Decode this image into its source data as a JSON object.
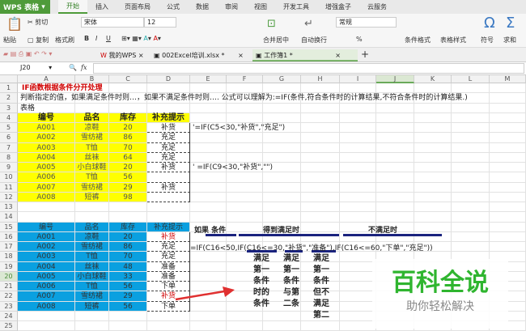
{
  "app": {
    "name": "WPS 表格",
    "menu_tabs": [
      "开始",
      "插入",
      "页面布局",
      "公式",
      "数据",
      "审阅",
      "视图",
      "开发工具",
      "增强盒子",
      "云服务"
    ],
    "active_tab": "开始"
  },
  "ribbon": {
    "paste": "粘贴",
    "cut": "剪切",
    "copy": "复制",
    "format_painter": "格式刷",
    "font": "宋体",
    "font_size": "12",
    "bold": "B",
    "italic": "I",
    "underline": "U",
    "merge": "合并居中",
    "wrap": "自动换行",
    "number_format": "常规",
    "percent": "%",
    "cond_format": "条件格式",
    "table_style": "表格样式",
    "symbol": "符号",
    "sum": "求和"
  },
  "doc_tabs": [
    {
      "label": "我的WPS"
    },
    {
      "label": "002Excel培训.xlsx *"
    },
    {
      "label": "工作簿1 *",
      "active": true
    }
  ],
  "formula_bar": {
    "cell_ref": "J20",
    "fx": "fx",
    "value": ""
  },
  "columns": [
    "A",
    "B",
    "C",
    "D",
    "E",
    "F",
    "G",
    "H",
    "I",
    "J",
    "K",
    "L",
    "M"
  ],
  "selected_column": "J",
  "selected_row": 20,
  "rows": 25,
  "colors": {
    "yellow": "#ffff00",
    "blue": "#0aa0e0",
    "red": "#d00000",
    "navy": "#1a237e",
    "green": "#2fb52f"
  },
  "cells": [
    {
      "r": 1,
      "c": 0,
      "t": "IF函数根据条件分开处理",
      "s": "title"
    },
    {
      "r": 2,
      "c": 0,
      "t": "判断指定的值，如果满足条件时则…，如果不满足条件时则…. 公式可以理解为:=IF(条件,符合条件时的计算结果,不符合条件时的计算结果.)",
      "s": "left"
    },
    {
      "r": 3,
      "c": 0,
      "t": "表格",
      "s": "left"
    },
    {
      "r": 4,
      "c": 0,
      "t": "编号",
      "s": "yh"
    },
    {
      "r": 4,
      "c": 1,
      "t": "品名",
      "s": "yh"
    },
    {
      "r": 4,
      "c": 2,
      "t": "库存",
      "s": "yh"
    },
    {
      "r": 4,
      "c": 3,
      "t": "补充提示",
      "s": "yh"
    },
    {
      "r": 5,
      "c": 0,
      "t": "A001",
      "s": "y"
    },
    {
      "r": 5,
      "c": 1,
      "t": "凉鞋",
      "s": "y"
    },
    {
      "r": 5,
      "c": 2,
      "t": "20",
      "s": "y"
    },
    {
      "r": 5,
      "c": 3,
      "t": "补货",
      "s": "w"
    },
    {
      "r": 6,
      "c": 0,
      "t": "A002",
      "s": "y"
    },
    {
      "r": 6,
      "c": 1,
      "t": "雪纺裙",
      "s": "y"
    },
    {
      "r": 6,
      "c": 2,
      "t": "86",
      "s": "y"
    },
    {
      "r": 6,
      "c": 3,
      "t": "充足",
      "s": "w"
    },
    {
      "r": 7,
      "c": 0,
      "t": "A003",
      "s": "y"
    },
    {
      "r": 7,
      "c": 1,
      "t": "T恤",
      "s": "y"
    },
    {
      "r": 7,
      "c": 2,
      "t": "70",
      "s": "y"
    },
    {
      "r": 7,
      "c": 3,
      "t": "充足",
      "s": "w"
    },
    {
      "r": 8,
      "c": 0,
      "t": "A004",
      "s": "y"
    },
    {
      "r": 8,
      "c": 1,
      "t": "丝袜",
      "s": "y"
    },
    {
      "r": 8,
      "c": 2,
      "t": "64",
      "s": "y"
    },
    {
      "r": 8,
      "c": 3,
      "t": "充足",
      "s": "w"
    },
    {
      "r": 9,
      "c": 0,
      "t": "A005",
      "s": "y"
    },
    {
      "r": 9,
      "c": 1,
      "t": "小白球鞋",
      "s": "y"
    },
    {
      "r": 9,
      "c": 2,
      "t": "20",
      "s": "y"
    },
    {
      "r": 9,
      "c": 3,
      "t": "补货",
      "s": "w"
    },
    {
      "r": 10,
      "c": 0,
      "t": "A006",
      "s": "y"
    },
    {
      "r": 10,
      "c": 1,
      "t": "T恤",
      "s": "y"
    },
    {
      "r": 10,
      "c": 2,
      "t": "56",
      "s": "y"
    },
    {
      "r": 10,
      "c": 3,
      "t": "",
      "s": "w"
    },
    {
      "r": 11,
      "c": 0,
      "t": "A007",
      "s": "y"
    },
    {
      "r": 11,
      "c": 1,
      "t": "雪纺裙",
      "s": "y"
    },
    {
      "r": 11,
      "c": 2,
      "t": "29",
      "s": "y"
    },
    {
      "r": 11,
      "c": 3,
      "t": "补货",
      "s": "w"
    },
    {
      "r": 12,
      "c": 0,
      "t": "A008",
      "s": "y"
    },
    {
      "r": 12,
      "c": 1,
      "t": "短裤",
      "s": "y"
    },
    {
      "r": 12,
      "c": 2,
      "t": "98",
      "s": "y"
    },
    {
      "r": 12,
      "c": 3,
      "t": "",
      "s": "w"
    },
    {
      "r": 5,
      "c": 4,
      "t": "'=IF(C5<30,\"补货\",\"充足\")",
      "s": "left"
    },
    {
      "r": 9,
      "c": 4,
      "t": "' =IF(C9<30,\"补货\",\"\")",
      "s": "left"
    },
    {
      "r": 15,
      "c": 0,
      "t": "编号",
      "s": "b"
    },
    {
      "r": 15,
      "c": 1,
      "t": "品名",
      "s": "b"
    },
    {
      "r": 15,
      "c": 2,
      "t": "库存",
      "s": "b"
    },
    {
      "r": 15,
      "c": 3,
      "t": "补充提示",
      "s": "b"
    },
    {
      "r": 16,
      "c": 0,
      "t": "A001",
      "s": "b"
    },
    {
      "r": 16,
      "c": 1,
      "t": "凉鞋",
      "s": "b"
    },
    {
      "r": 16,
      "c": 2,
      "t": "20",
      "s": "b"
    },
    {
      "r": 16,
      "c": 3,
      "t": "补货",
      "s": "wr"
    },
    {
      "r": 17,
      "c": 0,
      "t": "A002",
      "s": "b"
    },
    {
      "r": 17,
      "c": 1,
      "t": "雪纺裙",
      "s": "b"
    },
    {
      "r": 17,
      "c": 2,
      "t": "86",
      "s": "b"
    },
    {
      "r": 17,
      "c": 3,
      "t": "充足",
      "s": "w"
    },
    {
      "r": 18,
      "c": 0,
      "t": "A003",
      "s": "b"
    },
    {
      "r": 18,
      "c": 1,
      "t": "T恤",
      "s": "b"
    },
    {
      "r": 18,
      "c": 2,
      "t": "70",
      "s": "b"
    },
    {
      "r": 18,
      "c": 3,
      "t": "充足",
      "s": "w"
    },
    {
      "r": 19,
      "c": 0,
      "t": "A004",
      "s": "b"
    },
    {
      "r": 19,
      "c": 1,
      "t": "丝袜",
      "s": "b"
    },
    {
      "r": 19,
      "c": 2,
      "t": "48",
      "s": "b"
    },
    {
      "r": 19,
      "c": 3,
      "t": "准备",
      "s": "w"
    },
    {
      "r": 20,
      "c": 0,
      "t": "A005",
      "s": "b"
    },
    {
      "r": 20,
      "c": 1,
      "t": "小白球鞋",
      "s": "b"
    },
    {
      "r": 20,
      "c": 2,
      "t": "33",
      "s": "b"
    },
    {
      "r": 20,
      "c": 3,
      "t": "准备",
      "s": "w"
    },
    {
      "r": 21,
      "c": 0,
      "t": "A006",
      "s": "b"
    },
    {
      "r": 21,
      "c": 1,
      "t": "T恤",
      "s": "b"
    },
    {
      "r": 21,
      "c": 2,
      "t": "56",
      "s": "b"
    },
    {
      "r": 21,
      "c": 3,
      "t": "下单",
      "s": "w"
    },
    {
      "r": 22,
      "c": 0,
      "t": "A007",
      "s": "b"
    },
    {
      "r": 22,
      "c": 1,
      "t": "雪纺裙",
      "s": "b"
    },
    {
      "r": 22,
      "c": 2,
      "t": "29",
      "s": "b"
    },
    {
      "r": 22,
      "c": 3,
      "t": "补货",
      "s": "wr"
    },
    {
      "r": 23,
      "c": 0,
      "t": "A008",
      "s": "b"
    },
    {
      "r": 23,
      "c": 1,
      "t": "短裤",
      "s": "b"
    },
    {
      "r": 23,
      "c": 2,
      "t": "56",
      "s": "b"
    },
    {
      "r": 23,
      "c": 3,
      "t": "下单",
      "s": "w"
    }
  ],
  "annotations": {
    "if_cond": "如果 条件",
    "true_label": "得到满足时",
    "false_label": "不满足时",
    "formula": "=IF(C16<50,IF(C16<=30,\"补货\",\"准备\"),IF(C16<=60,\"下单\",\"充足\"))",
    "note1": "满足\n第一\n条件\n时的\n条件",
    "note2": "满足\n第一\n条件\n与第\n二条",
    "note3": "满足\n第一\n条件\n但不\n满足\n第二"
  },
  "watermark": {
    "title": "百科全说",
    "subtitle": "助你轻松解决"
  }
}
